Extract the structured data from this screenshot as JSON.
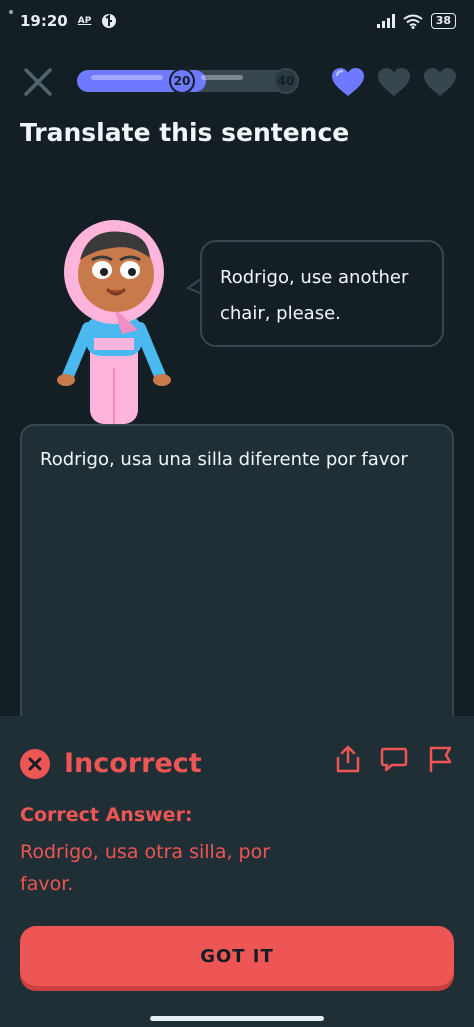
{
  "status_bar": {
    "time": "19:20",
    "indicator_ap": "AP",
    "battery": "38"
  },
  "top_bar": {
    "progress_fraction": 0.58,
    "milestone_current": "20",
    "milestone_end": "40",
    "hearts_full": 1,
    "hearts_total": 3,
    "accent_color": "#6f79ff"
  },
  "exercise": {
    "title": "Translate this sentence",
    "prompt_sentence": "Rodrigo, use another chair, please.",
    "user_answer": "Rodrigo, usa una silla diferente por favor"
  },
  "feedback": {
    "status": "Incorrect",
    "correct_answer_label": "Correct Answer:",
    "correct_answer": "Rodrigo, usa otra silla, por favor.",
    "button_label": "GOT IT",
    "error_color": "#ee5555"
  },
  "icons": {
    "close": "close-icon",
    "share": "share-icon",
    "comment": "comment-icon",
    "report": "flag-icon"
  }
}
